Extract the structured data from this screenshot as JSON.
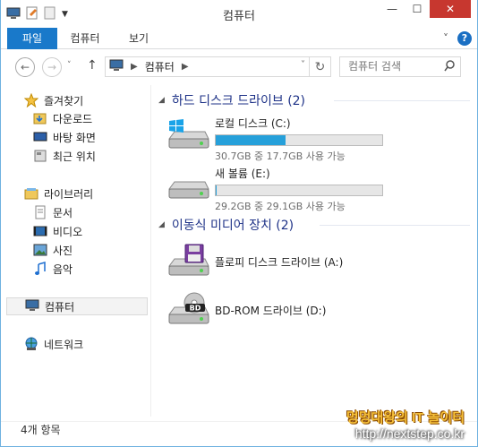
{
  "window": {
    "title": "컴퓨터",
    "minimize": "—",
    "maximize": "☐",
    "close": "✕"
  },
  "ribbon": {
    "tabs": [
      {
        "label": "파일"
      },
      {
        "label": "컴퓨터"
      },
      {
        "label": "보기"
      }
    ],
    "expand": "˅",
    "help": "?"
  },
  "addressbar": {
    "back": "←",
    "forward": "→",
    "history": "˅",
    "up": "↑",
    "path": "컴퓨터",
    "refresh": "↻",
    "search_placeholder": "컴퓨터 검색",
    "search_icon": "search-icon"
  },
  "nav": {
    "favorites": "즐겨찾기",
    "downloads": "다운로드",
    "desktop": "바탕 화면",
    "recent": "최근 위치",
    "libraries": "라이브러리",
    "documents": "문서",
    "videos": "비디오",
    "pictures": "사진",
    "music": "음악",
    "computer": "컴퓨터",
    "network": "네트워크"
  },
  "content": {
    "hdd_group": "하드 디스크 드라이브 (2)",
    "removable_group": "이동식 미디어 장치 (2)",
    "drives": [
      {
        "name": "로컬 디스크 (C:)",
        "size": "30.7GB 중 17.7GB 사용 가능",
        "used_fraction": 0.42
      },
      {
        "name": "새 볼륨 (E:)",
        "size": "29.2GB 중 29.1GB 사용 가능",
        "used_fraction": 0.003
      }
    ],
    "removable": [
      {
        "name": "플로피 디스크 드라이브 (A:)"
      },
      {
        "name": "BD-ROM 드라이브 (D:)"
      }
    ]
  },
  "status": {
    "items": "4개 항목"
  },
  "watermark": {
    "line1": "멍멍대왕의 IT 놀이터",
    "line2": "http://nextstep.co.kr"
  },
  "colors": {
    "accent": "#1979ca",
    "close": "#c7372f",
    "bar_fill": "#26a0da",
    "group_text": "#1e3287"
  }
}
